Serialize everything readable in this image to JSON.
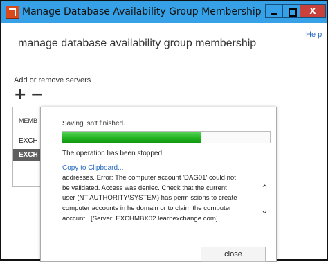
{
  "window": {
    "title": "Manage Database Availability Group Membership - Windo...",
    "min_glyph": "",
    "max_glyph": "",
    "close_glyph": "X",
    "help_label": "He p"
  },
  "page": {
    "title": "manage database availability group membership",
    "section_label": "Add or remove servers",
    "add_glyph": "+",
    "remove_glyph": "−"
  },
  "servers": {
    "header": "MEMB",
    "rows": [
      "EXCH",
      "EXCH"
    ]
  },
  "dialog": {
    "status": "Saving isn't finished.",
    "progress": 0.67,
    "stopped": "The operation has been stopped.",
    "copy_link": "Copy to Clipboard...",
    "error_lines": [
      "addresses. Error: The computer account 'DAG01' could not",
      "be validated. Access was deniec. Check that the current",
      "user (NT AUTHORITY\\SYSTEM) has perm ssions to create",
      "computer accounts in he domain or to claim the computer",
      "acccunt.. [Server: EXCHMBX02.learnexchange.com]"
    ],
    "scroll_up_glyph": "⌃",
    "scroll_down_glyph": "⌄",
    "close_label": "close"
  },
  "colors": {
    "titlebar": "#36a1e6",
    "progress": "#22b322",
    "link": "#2b6bbf"
  }
}
